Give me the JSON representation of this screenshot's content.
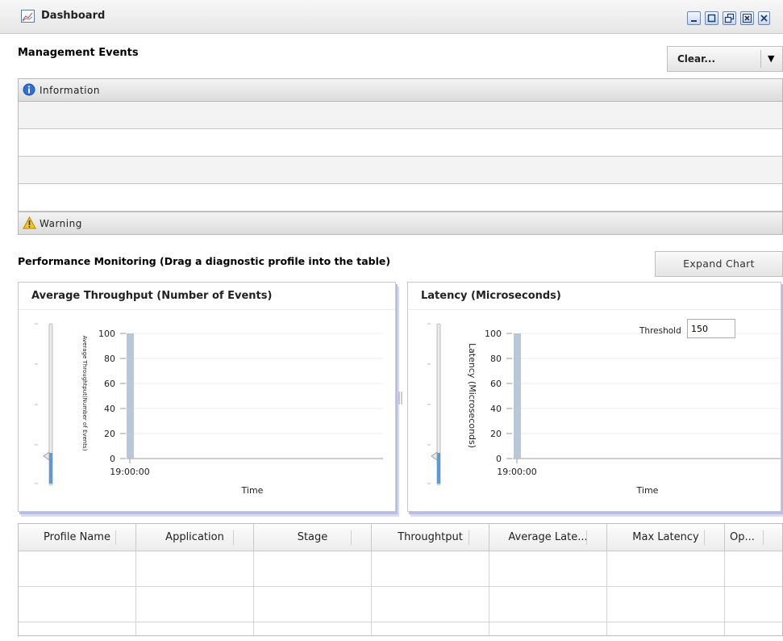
{
  "window": {
    "title": "Dashboard",
    "controls": [
      "minimize-icon",
      "maximize-icon",
      "restore-icon",
      "close-icon"
    ]
  },
  "management_events": {
    "title": "Management Events",
    "clear_select": {
      "value": "Clear..."
    },
    "information_label": "Information",
    "warning_label": "Warning"
  },
  "performance": {
    "title": "Performance Monitoring (Drag a diagnostic profile into the table)",
    "expand_button": "Expand Chart"
  },
  "throughput_chart": {
    "panel_title": "Average Throughput (Number of Events)",
    "y_ticks": [
      "100",
      "80",
      "60",
      "40",
      "20",
      "0"
    ],
    "x_tick": "19:00:00",
    "xlabel": "Time",
    "ylabel": "Average Throughtput(Number of Events)"
  },
  "latency_chart": {
    "panel_title": "Latency (Microseconds)",
    "y_ticks": [
      "100",
      "80",
      "60",
      "40",
      "20",
      "0"
    ],
    "x_tick": "19:00:00",
    "xlabel": "Time",
    "ylabel": "Latency (Microseconds)",
    "threshold_label": "Threshold",
    "threshold_value": "150"
  },
  "table": {
    "columns": [
      "Profile Name",
      "Application",
      "Stage",
      "Throughtput",
      "Average Late...",
      "Max Latency",
      "Op..."
    ]
  },
  "colors": {
    "accent_bar": "#b7c7dc",
    "panel_shadow": "#b9bde2"
  }
}
